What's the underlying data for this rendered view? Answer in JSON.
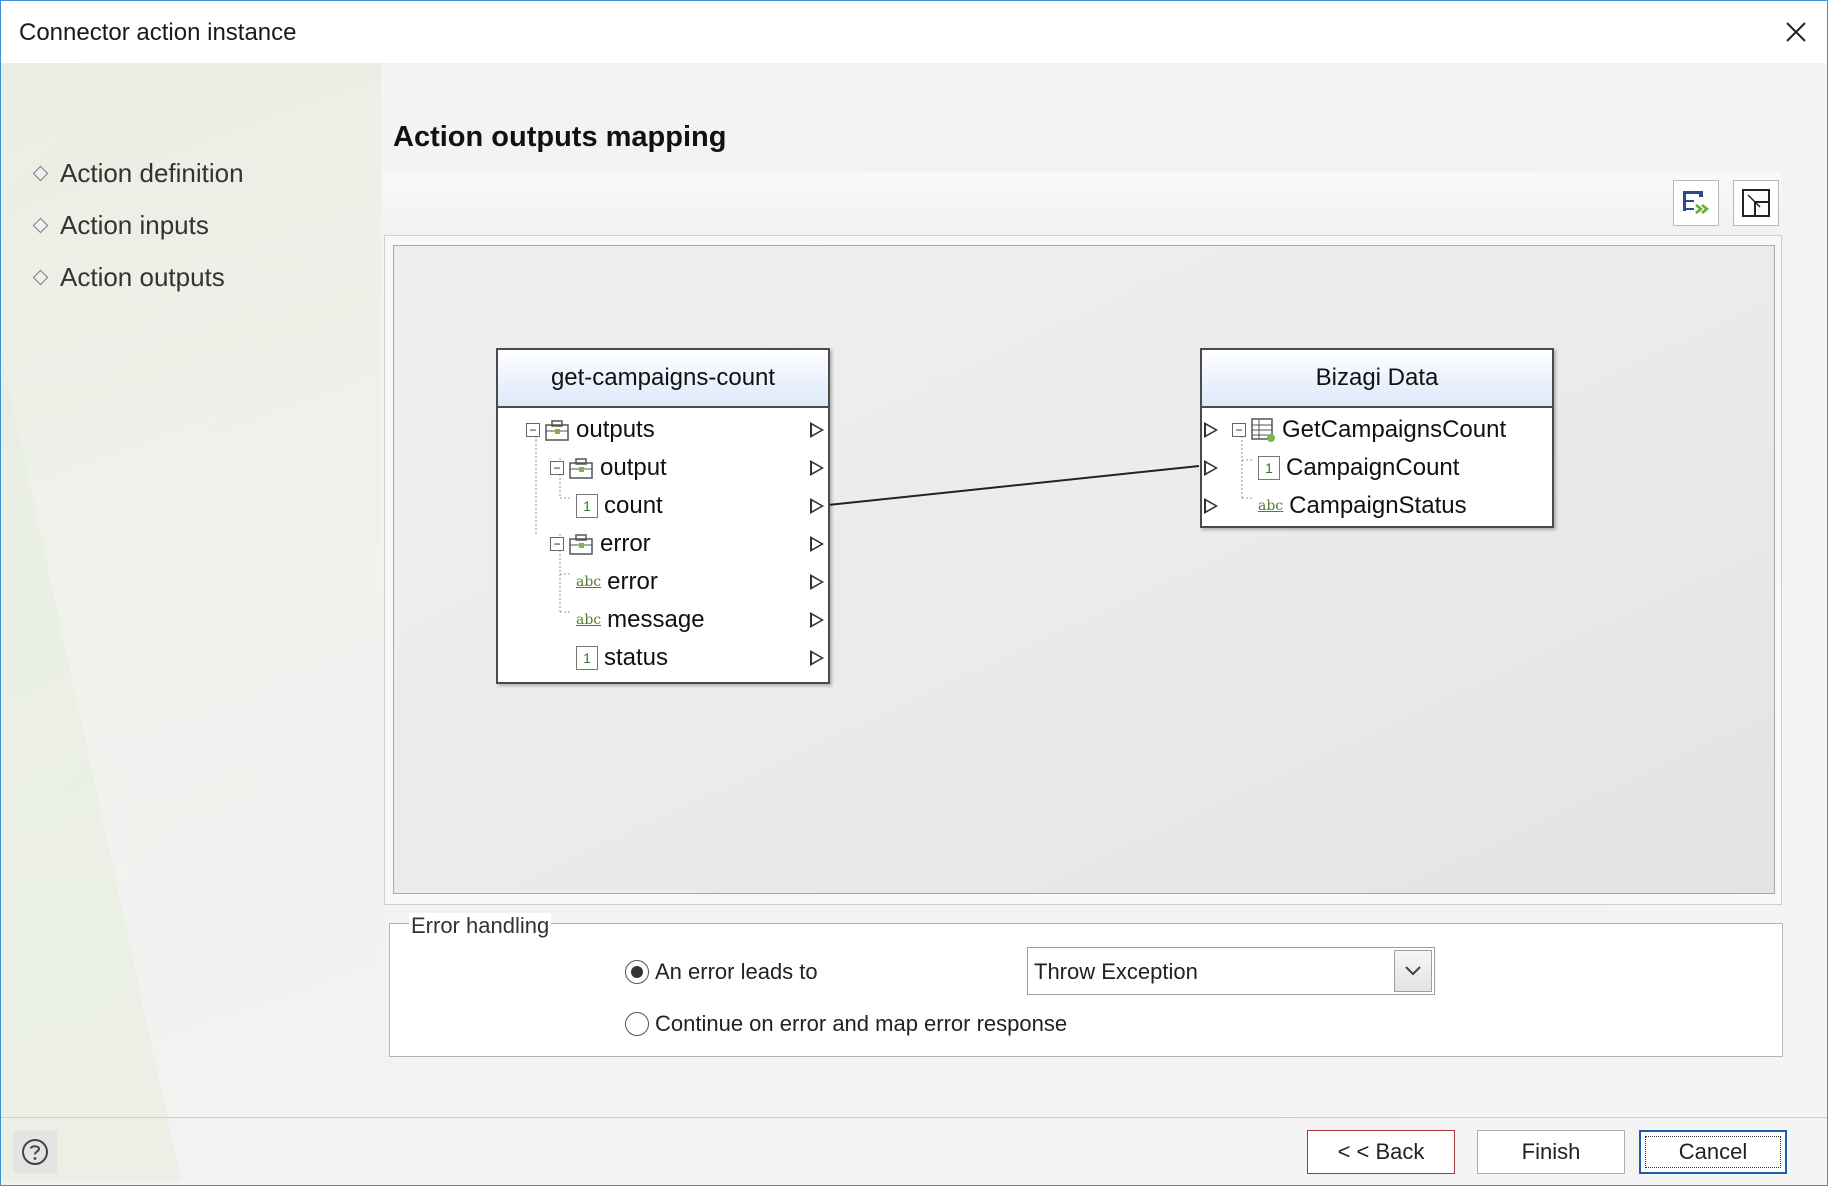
{
  "window": {
    "title": "Connector action instance"
  },
  "steps": [
    {
      "label": "Action definition"
    },
    {
      "label": "Action inputs"
    },
    {
      "label": "Action outputs"
    }
  ],
  "page": {
    "title": "Action outputs mapping"
  },
  "mapping": {
    "source": {
      "title": "get-campaigns-count",
      "rows": [
        "outputs",
        "output",
        "count",
        "error",
        "error",
        "message",
        "status"
      ]
    },
    "target": {
      "title": "Bizagi Data",
      "rows": [
        "GetCampaignsCount",
        "CampaignCount",
        "CampaignStatus"
      ]
    }
  },
  "error_handling": {
    "legend": "Error handling",
    "option_error_label": "An error leads to",
    "option_continue_label": "Continue on error and map error response",
    "selected_action": "Throw Exception",
    "selected_option": "error"
  },
  "footer": {
    "back_label": "< < Back",
    "finish_label": "Finish",
    "cancel_label": "Cancel"
  }
}
